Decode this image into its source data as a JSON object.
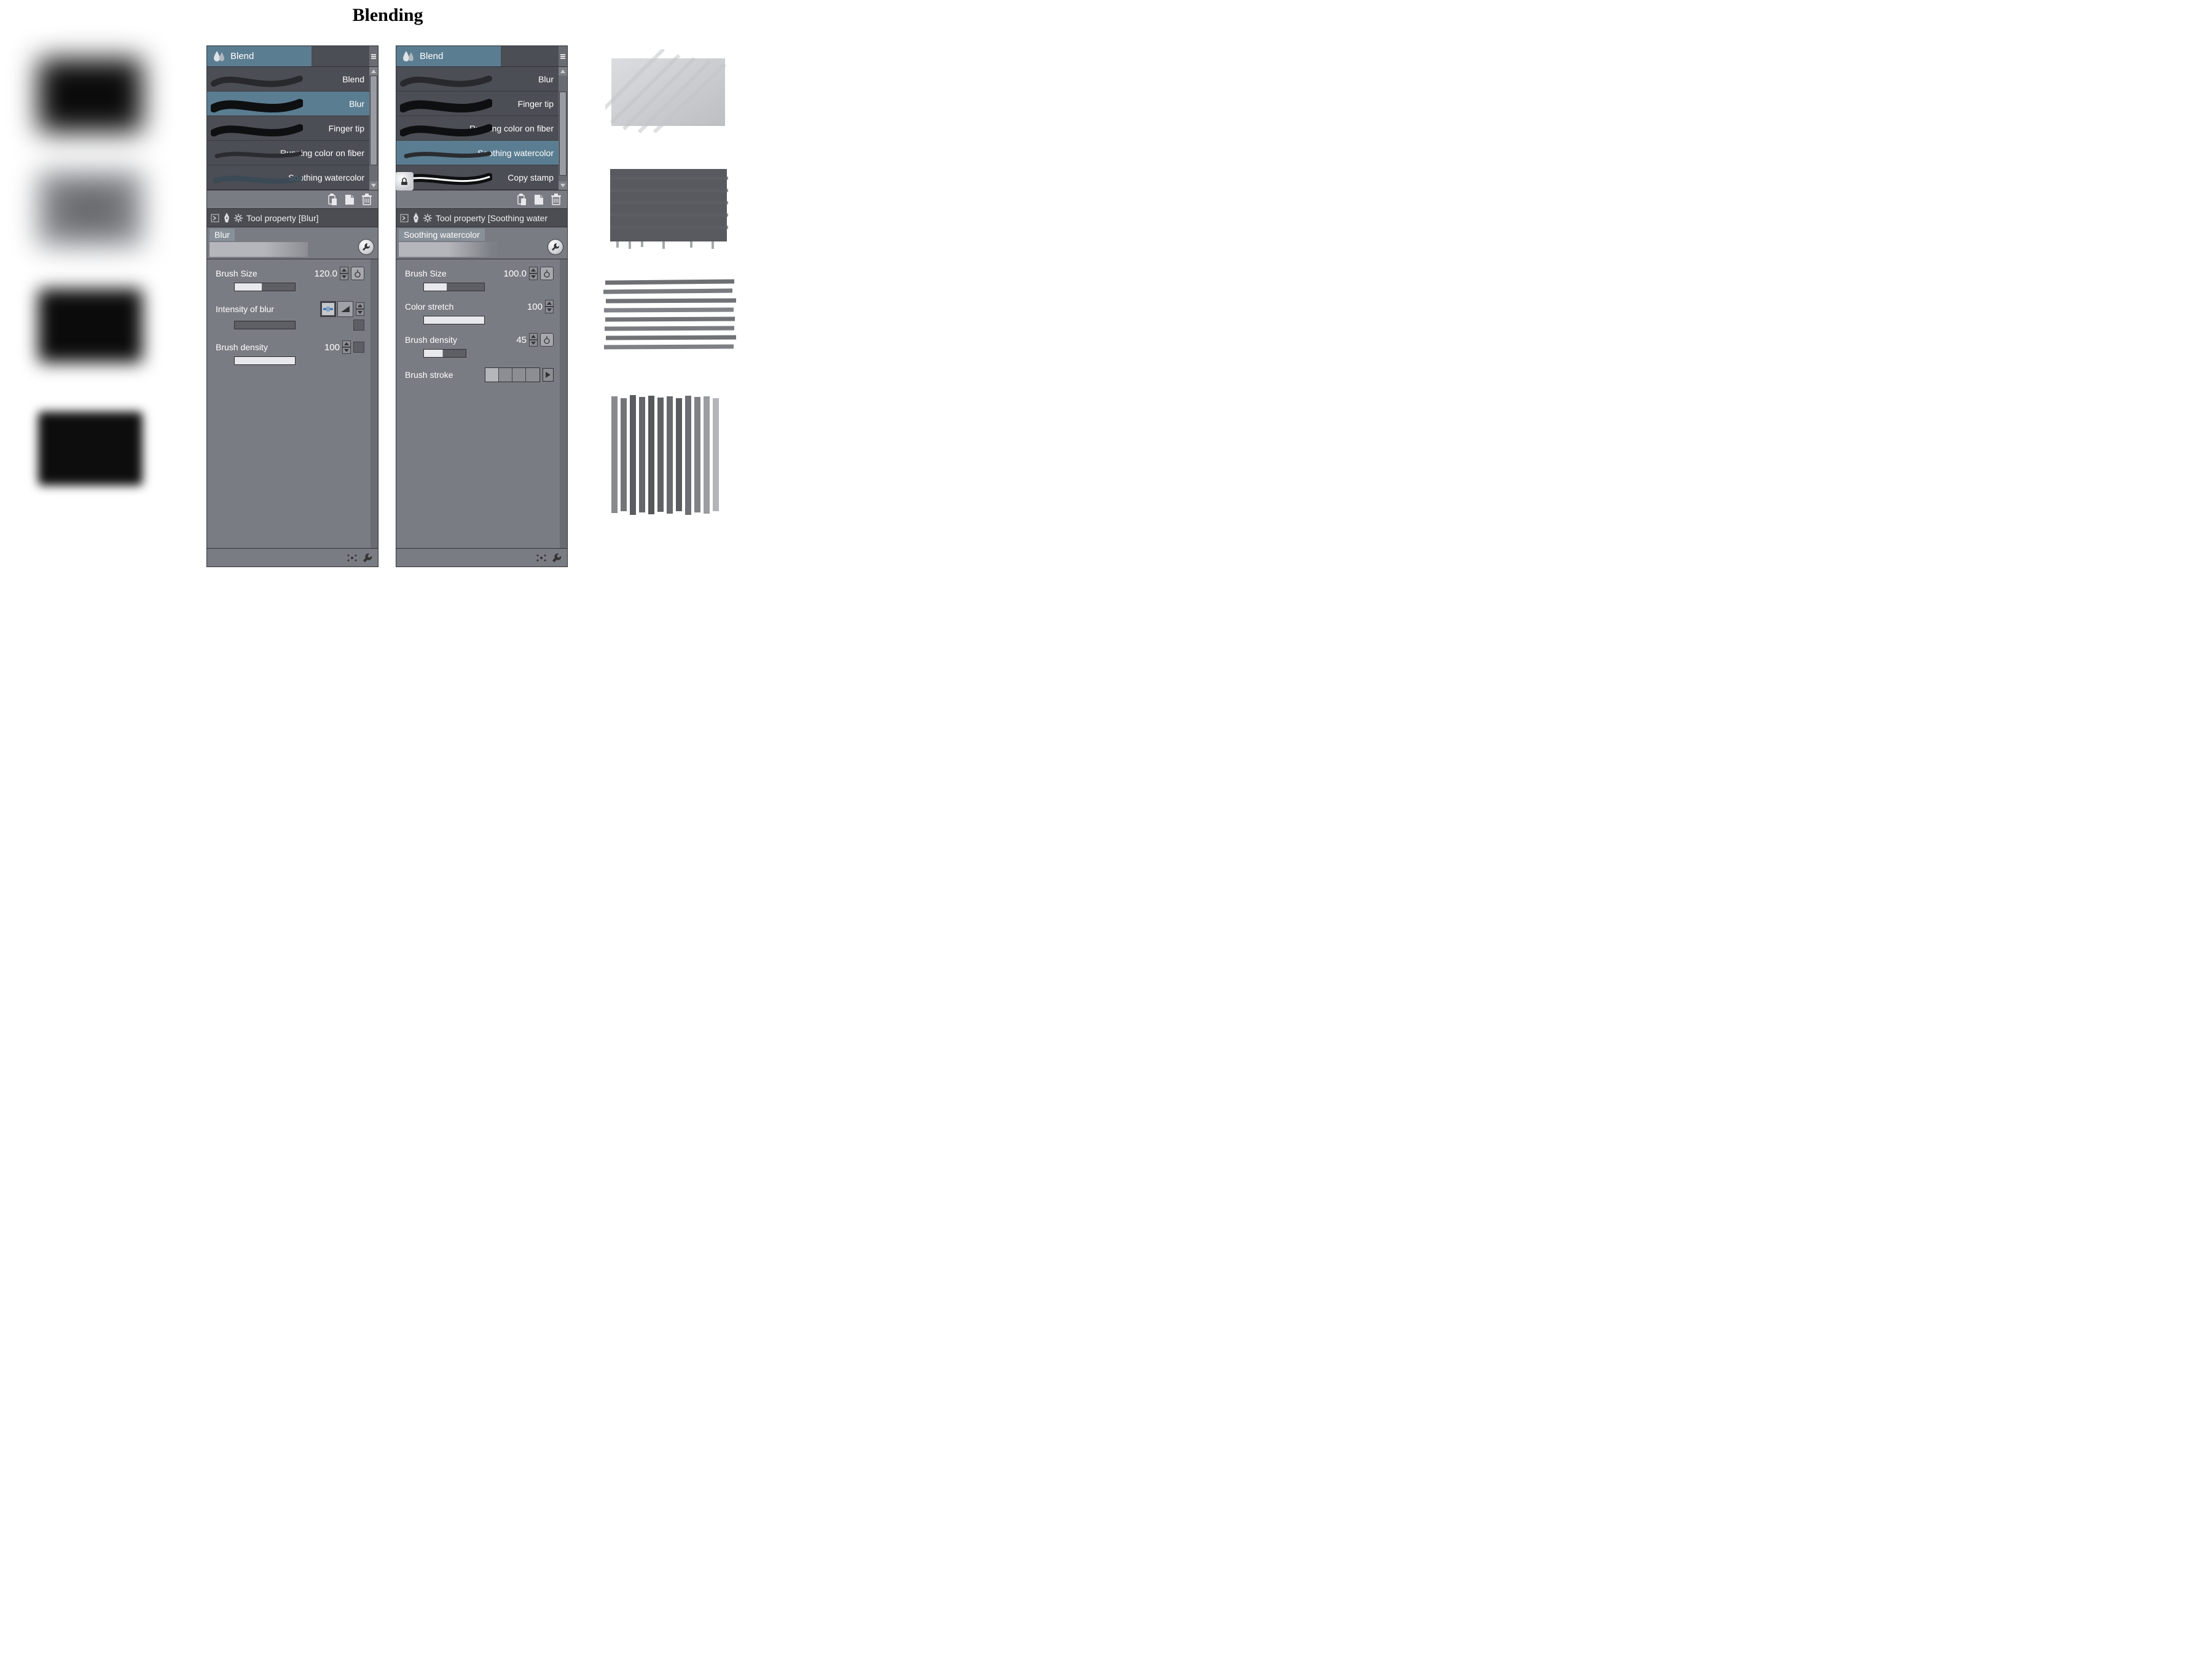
{
  "title": "Blending",
  "panel_left": {
    "tab": "Blend",
    "brushes": [
      "Blend",
      "Blur",
      "Finger tip",
      "Running color on fiber",
      "Soothing watercolor"
    ],
    "selected_index": 1,
    "tool_property_title": "Tool property [Blur]",
    "preview_name": "Blur",
    "props": {
      "brush_size": {
        "label": "Brush Size",
        "value": "120.0"
      },
      "intensity": {
        "label": "Intensity of blur"
      },
      "density": {
        "label": "Brush density",
        "value": "100"
      }
    }
  },
  "panel_right": {
    "tab": "Blend",
    "brushes": [
      "Blur",
      "Finger tip",
      "Running color on fiber",
      "Soothing watercolor",
      "Copy stamp"
    ],
    "selected_index": 3,
    "stamp_index": 4,
    "tool_property_title": "Tool property [Soothing water",
    "preview_name": "Soothing watercolor",
    "props": {
      "brush_size": {
        "label": "Brush Size",
        "value": "100.0"
      },
      "color_stretch": {
        "label": "Color stretch",
        "value": "100"
      },
      "density": {
        "label": "Brush density",
        "value": "45"
      },
      "stroke": {
        "label": "Brush stroke"
      }
    }
  }
}
